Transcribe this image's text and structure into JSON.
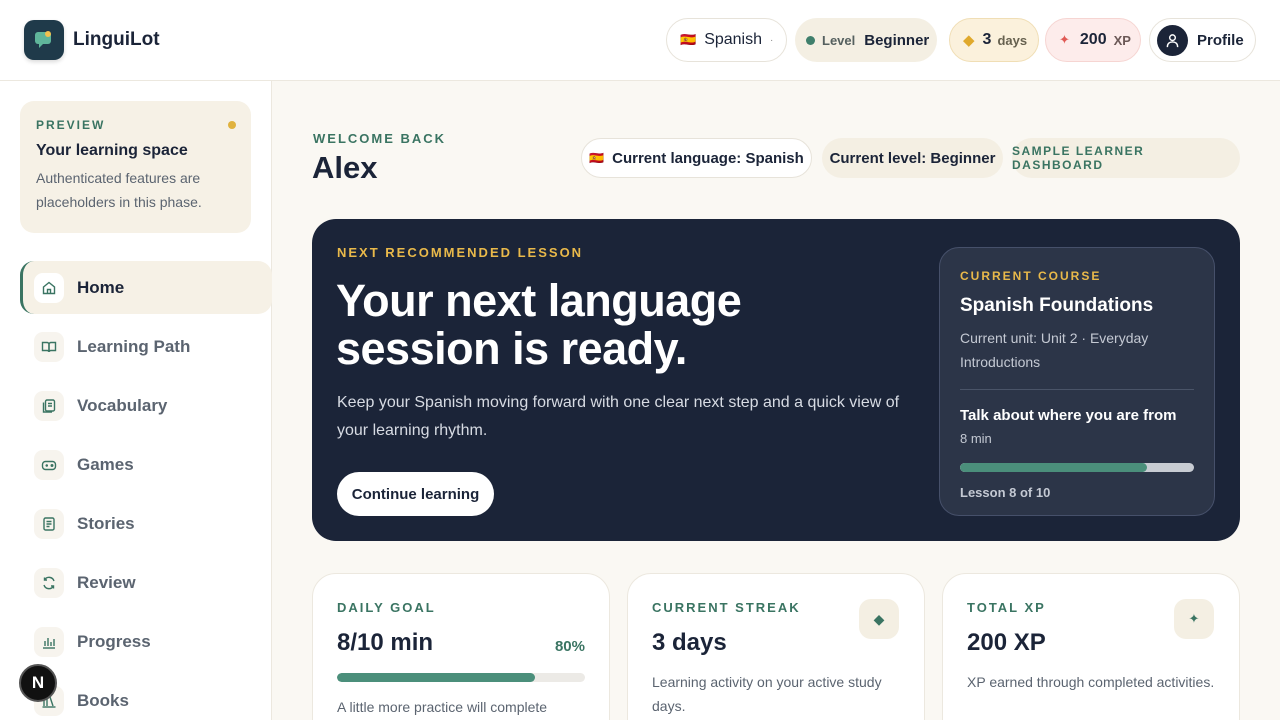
{
  "app": {
    "name": "LinguiLot"
  },
  "header": {
    "language": {
      "flag": "🇪🇸",
      "label": "Spanish",
      "chevron": "·"
    },
    "level": {
      "label": "Level",
      "value": "Beginner"
    },
    "streak": {
      "icon": "◆",
      "value": "3",
      "unit": "days"
    },
    "xp": {
      "icon": "✦",
      "value": "200",
      "unit": "XP"
    },
    "profile": {
      "label": "Profile"
    }
  },
  "sidebar": {
    "preview": {
      "eyebrow": "PREVIEW",
      "title": "Your learning space",
      "description": "Authenticated features are placeholders in this phase."
    },
    "items": [
      {
        "label": "Home",
        "icon": "home-icon",
        "active": true
      },
      {
        "label": "Learning Path",
        "icon": "book-open-icon",
        "active": false
      },
      {
        "label": "Vocabulary",
        "icon": "cards-icon",
        "active": false
      },
      {
        "label": "Games",
        "icon": "gamepad-icon",
        "active": false
      },
      {
        "label": "Stories",
        "icon": "story-icon",
        "active": false
      },
      {
        "label": "Review",
        "icon": "refresh-icon",
        "active": false
      },
      {
        "label": "Progress",
        "icon": "chart-icon",
        "active": false
      },
      {
        "label": "Books",
        "icon": "books-icon",
        "active": false
      }
    ]
  },
  "badge": {
    "letter": "N"
  },
  "welcome": {
    "eyebrow": "WELCOME BACK",
    "name": "Alex",
    "chips": {
      "language": {
        "flag": "🇪🇸",
        "label": "Current language: Spanish"
      },
      "level": "Current level: Beginner",
      "sample": "SAMPLE LEARNER DASHBOARD"
    }
  },
  "hero": {
    "eyebrow": "NEXT RECOMMENDED LESSON",
    "headline": "Your next language session is ready.",
    "description": "Keep your Spanish moving forward with one clear next step and a quick view of your learning rhythm.",
    "cta": "Continue learning",
    "course": {
      "eyebrow": "CURRENT COURSE",
      "title": "Spanish Foundations",
      "unit": "Current unit: Unit 2 · Everyday Introductions",
      "lesson": "Talk about where you are from",
      "duration": "8 min",
      "progress": 0.8,
      "count": "Lesson 8 of 10"
    }
  },
  "stats": {
    "daily_goal": {
      "eyebrow": "DAILY GOAL",
      "value": "8/10 min",
      "percent": "80%",
      "progress": 0.8,
      "note": "A little more practice will complete"
    },
    "streak": {
      "eyebrow": "CURRENT STREAK",
      "value": "3 days",
      "icon": "◆",
      "note": "Learning activity on your active study days."
    },
    "xp": {
      "eyebrow": "TOTAL XP",
      "value": "200 XP",
      "icon": "✦",
      "note": "XP earned through completed activities."
    }
  },
  "colors": {
    "navy": "#1b2438",
    "teal": "#3a7462",
    "gold": "#e9b94a",
    "cream": "#f6f1e6"
  }
}
